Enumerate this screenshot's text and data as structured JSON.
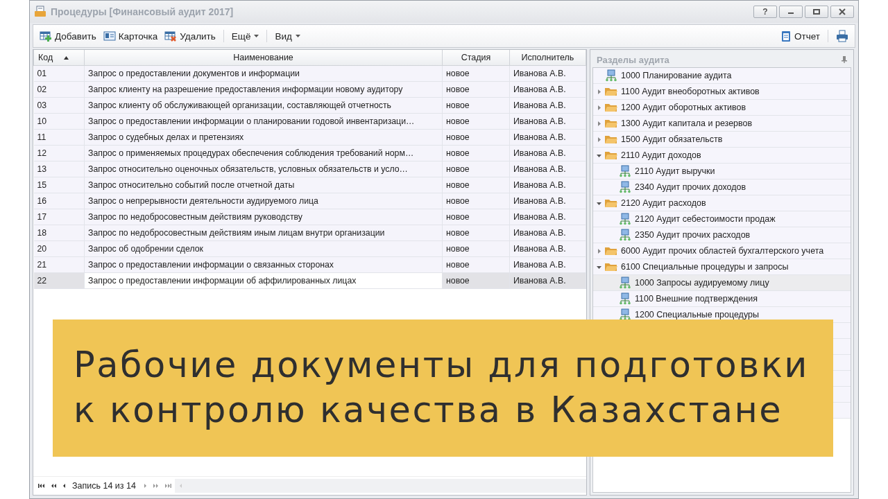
{
  "window": {
    "title": "Процедуры [Финансовый аудит 2017]",
    "help": "?"
  },
  "toolbar": {
    "items": [
      {
        "kind": "add",
        "label": "Добавить"
      },
      {
        "kind": "card",
        "label": "Карточка"
      },
      {
        "kind": "delete",
        "label": "Удалить"
      },
      {
        "kind": "menu",
        "label": "Ещё"
      },
      {
        "kind": "menu",
        "label": "Вид"
      }
    ],
    "right": [
      {
        "kind": "report",
        "label": "Отчет"
      },
      {
        "kind": "print"
      }
    ]
  },
  "table": {
    "columns": [
      {
        "label": "Код",
        "sorted": true
      },
      {
        "label": "Наименование",
        "sorted": false
      },
      {
        "label": "Стадия",
        "sorted": false
      },
      {
        "label": "Исполнитель",
        "sorted": false
      }
    ],
    "rows": [
      {
        "cells": [
          "01",
          "Запрос о предоставлении документов и информации",
          "новое",
          "Иванова А.В."
        ],
        "selected": false
      },
      {
        "cells": [
          "02",
          "Запрос клиенту на разрешение предоставления информации новому аудитору",
          "новое",
          "Иванова А.В."
        ],
        "selected": false
      },
      {
        "cells": [
          "03",
          "Запрос клиенту об обслуживающей организации, составляющей отчетность",
          "новое",
          "Иванова А.В."
        ],
        "selected": false
      },
      {
        "cells": [
          "10",
          "Запрос о предоставлении информации о планировании годовой инвентаризаци…",
          "новое",
          "Иванова А.В."
        ],
        "selected": false
      },
      {
        "cells": [
          "11",
          "Запрос о судебных делах и претензиях",
          "новое",
          "Иванова А.В."
        ],
        "selected": false
      },
      {
        "cells": [
          "12",
          "Запрос о применяемых процедурах обеспечения соблюдения требований норм…",
          "новое",
          "Иванова А.В."
        ],
        "selected": false
      },
      {
        "cells": [
          "13",
          "Запрос относительно оценочных обязательств, условных обязательств и усло…",
          "новое",
          "Иванова А.В."
        ],
        "selected": false
      },
      {
        "cells": [
          "15",
          "Запрос относительно событий после отчетной даты",
          "новое",
          "Иванова А.В."
        ],
        "selected": false
      },
      {
        "cells": [
          "16",
          "Запрос о непрерывности деятельности аудируемого лица",
          "новое",
          "Иванова А.В."
        ],
        "selected": false
      },
      {
        "cells": [
          "17",
          "Запрос по недобросовестным действиям руководству",
          "новое",
          "Иванова А.В."
        ],
        "selected": false
      },
      {
        "cells": [
          "18",
          "Запрос по недобросовестным действиям иным лицам внутри организации",
          "новое",
          "Иванова А.В."
        ],
        "selected": false
      },
      {
        "cells": [
          "20",
          "Запрос об одобрении сделок",
          "новое",
          "Иванова А.В."
        ],
        "selected": false
      },
      {
        "cells": [
          "21",
          "Запрос о предоставлении информации о связанных сторонах",
          "новое",
          "Иванова А.В."
        ],
        "selected": false
      },
      {
        "cells": [
          "22",
          "Запрос о предоставлении информации об аффилированных лицах",
          "новое",
          "Иванова А.В."
        ],
        "selected": true
      }
    ]
  },
  "pager": {
    "text": "Запись 14 из 14"
  },
  "side_panel": {
    "title": "Разделы аудита",
    "tree": [
      {
        "kind": "leaf",
        "label": "1000 Планирование аудита",
        "selected": false
      },
      {
        "kind": "folder",
        "label": "1100 Аудит внеоборотных активов",
        "expanded": false,
        "selected": false
      },
      {
        "kind": "folder",
        "label": "1200 Аудит оборотных активов",
        "expanded": false,
        "selected": false
      },
      {
        "kind": "folder",
        "label": "1300 Аудит капитала и резервов",
        "expanded": false,
        "selected": false
      },
      {
        "kind": "folder",
        "label": "1500 Аудит обязательств",
        "expanded": false,
        "selected": false
      },
      {
        "kind": "folder",
        "label": "2110 Аудит доходов",
        "expanded": true,
        "selected": false,
        "children": [
          {
            "kind": "leaf",
            "label": "2110 Аудит выручки",
            "selected": false
          },
          {
            "kind": "leaf",
            "label": "2340 Аудит прочих доходов",
            "selected": false
          }
        ]
      },
      {
        "kind": "folder",
        "label": "2120 Аудит расходов",
        "expanded": true,
        "selected": false,
        "children": [
          {
            "kind": "leaf",
            "label": "2120 Аудит себестоимости продаж",
            "selected": false
          },
          {
            "kind": "leaf",
            "label": "2350 Аудит прочих расходов",
            "selected": false
          }
        ]
      },
      {
        "kind": "folder",
        "label": "6000 Аудит прочих областей бухгалтерского учета",
        "expanded": false,
        "selected": false
      },
      {
        "kind": "folder",
        "label": "6100 Специальные процедуры и запросы",
        "expanded": true,
        "selected": false,
        "children": [
          {
            "kind": "leaf",
            "label": "1000 Запросы аудируемому лицу",
            "selected": true
          },
          {
            "kind": "leaf",
            "label": "1100 Внешние подтверждения",
            "selected": false
          },
          {
            "kind": "leaf",
            "label": "1200 Специальные процедуры",
            "selected": false
          }
        ]
      }
    ]
  },
  "banner": {
    "lines": [
      "Рабочие документы для подготовки",
      "к контролю качества в Казахстане"
    ]
  }
}
